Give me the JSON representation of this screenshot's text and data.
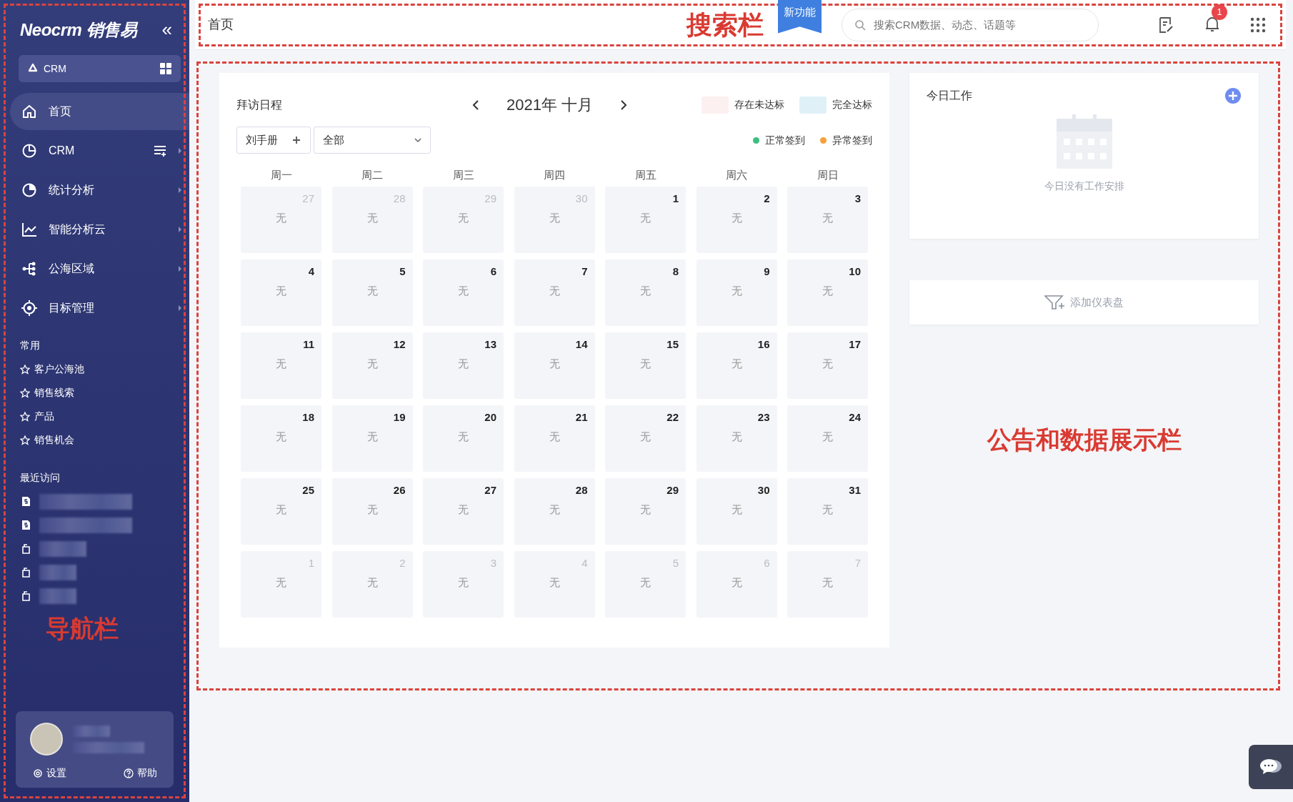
{
  "sidebar": {
    "logo": "Neocrm 销售易",
    "collapse": "«",
    "app_switch": {
      "label": "CRM"
    },
    "nav": [
      {
        "label": "首页",
        "kind": "home",
        "selected": true,
        "has_submenu": false,
        "extra": false
      },
      {
        "label": "CRM",
        "kind": "pie",
        "selected": false,
        "has_submenu": true,
        "extra": true
      },
      {
        "label": "统计分析",
        "kind": "piefill",
        "selected": false,
        "has_submenu": true,
        "extra": false
      },
      {
        "label": "智能分析云",
        "kind": "chart",
        "selected": false,
        "has_submenu": true,
        "extra": false
      },
      {
        "label": "公海区域",
        "kind": "tree",
        "selected": false,
        "has_submenu": true,
        "extra": false
      },
      {
        "label": "目标管理",
        "kind": "target",
        "selected": false,
        "has_submenu": true,
        "extra": false
      }
    ],
    "favorites_title": "常用",
    "favorites": [
      "客户公海池",
      "销售线索",
      "产品",
      "销售机会"
    ],
    "recent_title": "最近访问",
    "recent": [
      {
        "kind": "document"
      },
      {
        "kind": "document"
      },
      {
        "kind": "bag"
      },
      {
        "kind": "bag"
      },
      {
        "kind": "bag"
      }
    ],
    "annotation": "导航栏",
    "user": {
      "settings": "设置",
      "help": "帮助"
    }
  },
  "header": {
    "breadcrumb": "首页",
    "annotation": "搜索栏",
    "new_badge": "新功能",
    "search": {
      "placeholder": "搜索CRM数据、动态、话题等"
    },
    "notifications": "1"
  },
  "calendar": {
    "title": "拜访日程",
    "month": "2021年 十月",
    "owner": "刘手册",
    "filter": "全部",
    "legend": [
      {
        "label": "存在未达标",
        "color": "#fdf0f0",
        "kind": "swatch"
      },
      {
        "label": "完全达标",
        "color": "#dff1f7",
        "kind": "swatch"
      },
      {
        "label": "正常签到",
        "color": "#3bbf7f",
        "kind": "dot"
      },
      {
        "label": "异常签到",
        "color": "#f5a03a",
        "kind": "dot"
      }
    ],
    "weekdays": [
      "周一",
      "周二",
      "周三",
      "周四",
      "周五",
      "周六",
      "周日"
    ],
    "weeks": [
      [
        {
          "day": "27",
          "text": "无",
          "in_month": false
        },
        {
          "day": "28",
          "text": "无",
          "in_month": false
        },
        {
          "day": "29",
          "text": "无",
          "in_month": false
        },
        {
          "day": "30",
          "text": "无",
          "in_month": false
        },
        {
          "day": "1",
          "text": "无",
          "in_month": true
        },
        {
          "day": "2",
          "text": "无",
          "in_month": true
        },
        {
          "day": "3",
          "text": "无",
          "in_month": true
        }
      ],
      [
        {
          "day": "4",
          "text": "无",
          "in_month": true
        },
        {
          "day": "5",
          "text": "无",
          "in_month": true
        },
        {
          "day": "6",
          "text": "无",
          "in_month": true
        },
        {
          "day": "7",
          "text": "无",
          "in_month": true
        },
        {
          "day": "8",
          "text": "无",
          "in_month": true
        },
        {
          "day": "9",
          "text": "无",
          "in_month": true
        },
        {
          "day": "10",
          "text": "无",
          "in_month": true
        }
      ],
      [
        {
          "day": "11",
          "text": "无",
          "in_month": true
        },
        {
          "day": "12",
          "text": "无",
          "in_month": true
        },
        {
          "day": "13",
          "text": "无",
          "in_month": true
        },
        {
          "day": "14",
          "text": "无",
          "in_month": true
        },
        {
          "day": "15",
          "text": "无",
          "in_month": true
        },
        {
          "day": "16",
          "text": "无",
          "in_month": true
        },
        {
          "day": "17",
          "text": "无",
          "in_month": true
        }
      ],
      [
        {
          "day": "18",
          "text": "无",
          "in_month": true
        },
        {
          "day": "19",
          "text": "无",
          "in_month": true
        },
        {
          "day": "20",
          "text": "无",
          "in_month": true
        },
        {
          "day": "21",
          "text": "无",
          "in_month": true
        },
        {
          "day": "22",
          "text": "无",
          "in_month": true
        },
        {
          "day": "23",
          "text": "无",
          "in_month": true
        },
        {
          "day": "24",
          "text": "无",
          "in_month": true
        }
      ],
      [
        {
          "day": "25",
          "text": "无",
          "in_month": true
        },
        {
          "day": "26",
          "text": "无",
          "in_month": true
        },
        {
          "day": "27",
          "text": "无",
          "in_month": true
        },
        {
          "day": "28",
          "text": "无",
          "in_month": true
        },
        {
          "day": "29",
          "text": "无",
          "in_month": true
        },
        {
          "day": "30",
          "text": "无",
          "in_month": true
        },
        {
          "day": "31",
          "text": "无",
          "in_month": true
        }
      ],
      [
        {
          "day": "1",
          "text": "无",
          "in_month": false
        },
        {
          "day": "2",
          "text": "无",
          "in_month": false
        },
        {
          "day": "3",
          "text": "无",
          "in_month": false
        },
        {
          "day": "4",
          "text": "无",
          "in_month": false
        },
        {
          "day": "5",
          "text": "无",
          "in_month": false
        },
        {
          "day": "6",
          "text": "无",
          "in_month": false
        },
        {
          "day": "7",
          "text": "无",
          "in_month": false
        }
      ]
    ]
  },
  "today": {
    "title": "今日工作",
    "empty": "今日没有工作安排"
  },
  "dashboard": {
    "label": "添加仪表盘"
  },
  "panel_annotation": "公告和数据展示栏"
}
